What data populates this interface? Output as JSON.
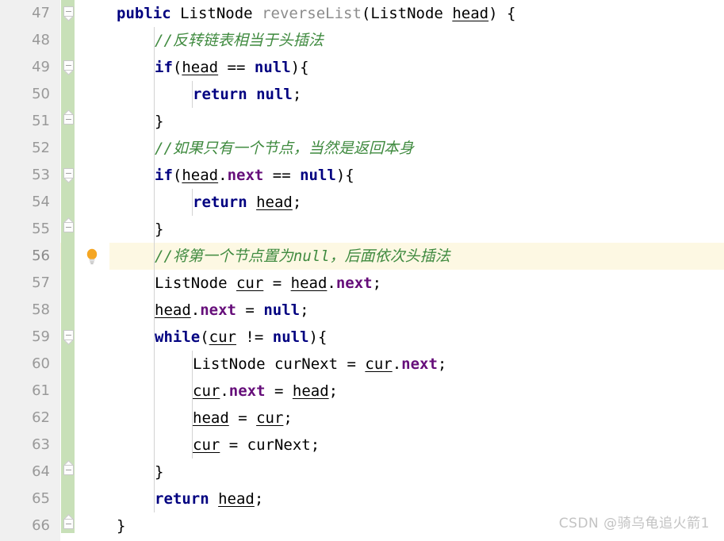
{
  "editor": {
    "first_line_number": 47,
    "line_height": 34,
    "highlighted_line": 56,
    "gutter_width": 75,
    "colors": {
      "background": "#ffffff",
      "gutter_background": "#f0f0f0",
      "line_number": "#999999",
      "change_marker": "#c8e0b8",
      "highlight_row": "#fdf8e3",
      "keyword": "#000080",
      "comment": "#3f8a3f",
      "field": "#660e7a",
      "method": "#8c8c8c",
      "indent_guide": "#d3d3d3",
      "watermark": "#c3c3c3",
      "bulb": "#f0a92e"
    }
  },
  "gutter": {
    "line_numbers": [
      "47",
      "48",
      "49",
      "50",
      "51",
      "52",
      "53",
      "54",
      "55",
      "56",
      "57",
      "58",
      "59",
      "60",
      "61",
      "62",
      "63",
      "64",
      "65",
      "66"
    ],
    "fold_markers": [
      {
        "line": 47,
        "type": "start"
      },
      {
        "line": 49,
        "type": "start"
      },
      {
        "line": 51,
        "type": "end"
      },
      {
        "line": 53,
        "type": "start"
      },
      {
        "line": 55,
        "type": "end"
      },
      {
        "line": 59,
        "type": "start"
      },
      {
        "line": 64,
        "type": "end"
      },
      {
        "line": 66,
        "type": "end"
      }
    ],
    "intention_bulb": {
      "line": 56,
      "icon": "lightbulb-icon",
      "tooltip": "Show Context Actions"
    }
  },
  "code": {
    "language": "java",
    "lines": [
      {
        "n": "47",
        "indent": 1,
        "text": "public ListNode reverseList(ListNode head) {"
      },
      {
        "n": "48",
        "indent": 2,
        "text": "//反转链表相当于头插法"
      },
      {
        "n": "49",
        "indent": 2,
        "text": "if(head == null){"
      },
      {
        "n": "50",
        "indent": 3,
        "text": "return null;"
      },
      {
        "n": "51",
        "indent": 2,
        "text": "}"
      },
      {
        "n": "52",
        "indent": 2,
        "text": "//如果只有一个节点，当然是返回本身"
      },
      {
        "n": "53",
        "indent": 2,
        "text": "if(head.next == null){"
      },
      {
        "n": "54",
        "indent": 3,
        "text": "return head;"
      },
      {
        "n": "55",
        "indent": 2,
        "text": "}"
      },
      {
        "n": "56",
        "indent": 2,
        "text": "//将第一个节点置为null，后面依次头插法"
      },
      {
        "n": "57",
        "indent": 2,
        "text": "ListNode cur = head.next;"
      },
      {
        "n": "58",
        "indent": 2,
        "text": "head.next = null;"
      },
      {
        "n": "59",
        "indent": 2,
        "text": "while(cur != null){"
      },
      {
        "n": "60",
        "indent": 3,
        "text": "ListNode curNext = cur.next;"
      },
      {
        "n": "61",
        "indent": 3,
        "text": "cur.next = head;"
      },
      {
        "n": "62",
        "indent": 3,
        "text": "head = cur;"
      },
      {
        "n": "63",
        "indent": 3,
        "text": "cur = curNext;"
      },
      {
        "n": "64",
        "indent": 2,
        "text": "}"
      },
      {
        "n": "65",
        "indent": 2,
        "text": "return head;"
      },
      {
        "n": "66",
        "indent": 1,
        "text": "}"
      }
    ]
  },
  "watermark": {
    "text": "CSDN @骑乌龟追火箭1"
  }
}
